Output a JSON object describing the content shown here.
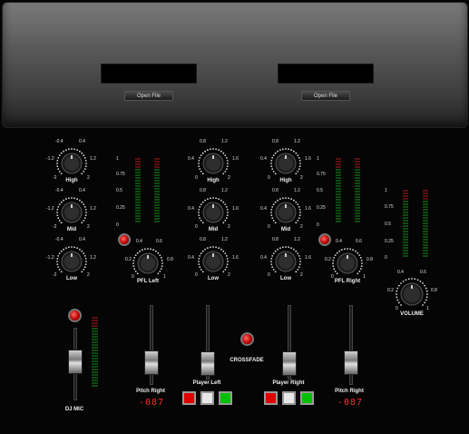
{
  "decks": {
    "left_open_file": "Open File",
    "right_open_file": "Open File"
  },
  "eq_left": {
    "high": "High",
    "mid": "Mid",
    "low": "Low",
    "ticks": {
      "outer_neg": "-2",
      "inner_neg": "-1.2",
      "top_neg": "-0.4",
      "top_pos": "0.4",
      "inner_pos": "1.2",
      "outer_pos": "2"
    }
  },
  "eq_center_left": {
    "high": "High",
    "mid": "Mid",
    "low": "Low",
    "ticks": {
      "outer_neg": "0",
      "inner_neg": "0.4",
      "top_neg": "0.8",
      "top_pos": "1.2",
      "inner_pos": "1.6",
      "outer_pos": "2"
    }
  },
  "eq_center_right": {
    "high": "High",
    "mid": "Mid",
    "low": "Low",
    "ticks": {
      "outer_neg": "0",
      "inner_neg": "0.4",
      "top_neg": "0.8",
      "top_pos": "1.2",
      "inner_pos": "1.6",
      "outer_pos": "2"
    }
  },
  "pfl_left": {
    "label": "PFL Left",
    "ticks": {
      "outer_neg": "0",
      "inner_neg": "0.2",
      "top_neg": "0.4",
      "top_pos": "0.6",
      "inner_pos": "0.8",
      "outer_pos": "1"
    }
  },
  "pfl_right": {
    "label": "PFL Right",
    "ticks": {
      "outer_neg": "0",
      "inner_neg": "0.2",
      "top_neg": "0.4",
      "top_pos": "0.6",
      "inner_pos": "0.8",
      "outer_pos": "1"
    }
  },
  "volume": {
    "label": "VOLUME",
    "ticks": {
      "outer_neg": "0",
      "inner_neg": "0.2",
      "top_neg": "0.4",
      "top_pos": "0.6",
      "inner_pos": "0.8",
      "outer_pos": "1"
    }
  },
  "meter_scale": [
    "1",
    "0.75",
    "0.5",
    "0.25",
    "0"
  ],
  "faders": {
    "dj_mic": "DJ MIC",
    "pitch_left_label": "Pitch Right",
    "pitch_left_value": "-087",
    "player_left": "Player Left",
    "crossfade": "CROSSFADE",
    "player_right": "Player Right",
    "pitch_right_label": "Pitch Right",
    "pitch_right_value": "-087"
  },
  "colors": {
    "led_green": "#00c000",
    "led_red": "#d00000",
    "digit_red": "#ff2a2a"
  }
}
